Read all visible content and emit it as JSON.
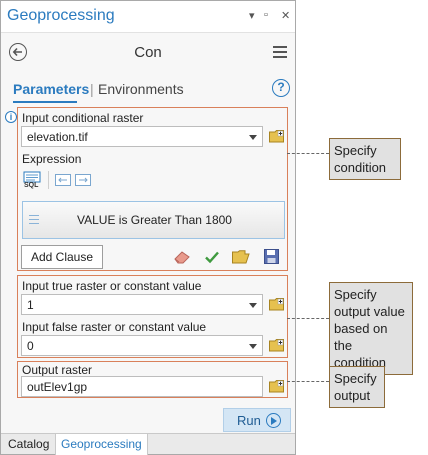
{
  "window": {
    "title": "Geoprocessing",
    "controls": [
      "▾",
      "▫",
      "✕"
    ]
  },
  "tool": {
    "name": "Con"
  },
  "tabs": {
    "parameters": "Parameters",
    "separator": "|",
    "environments": "Environments",
    "help": "?"
  },
  "params": {
    "cond_raster_label": "Input conditional raster",
    "cond_raster_value": "elevation.tif",
    "expression_label": "Expression",
    "sql_icon_text": "SQL",
    "expression_text": "VALUE  is Greater Than  1800",
    "add_clause": "Add Clause",
    "true_label": "Input true raster or constant value",
    "true_value": "1",
    "false_label": "Input false raster or constant value",
    "false_value": "0",
    "output_label": "Output raster",
    "output_value": "outElev1gp"
  },
  "run": {
    "label": "Run"
  },
  "bottom_tabs": [
    "Catalog",
    "Geoprocessing"
  ],
  "callouts": {
    "condition": [
      "Specify",
      "condition"
    ],
    "value": [
      "Specify",
      "output value",
      "based on the",
      "condition"
    ],
    "output": [
      "Specify",
      "output"
    ]
  },
  "colors": {
    "accent": "#2b7bbf",
    "highlight_box": "#d9805a",
    "callout_bg": "#e1e1e1",
    "callout_border": "#8c6b3a"
  }
}
